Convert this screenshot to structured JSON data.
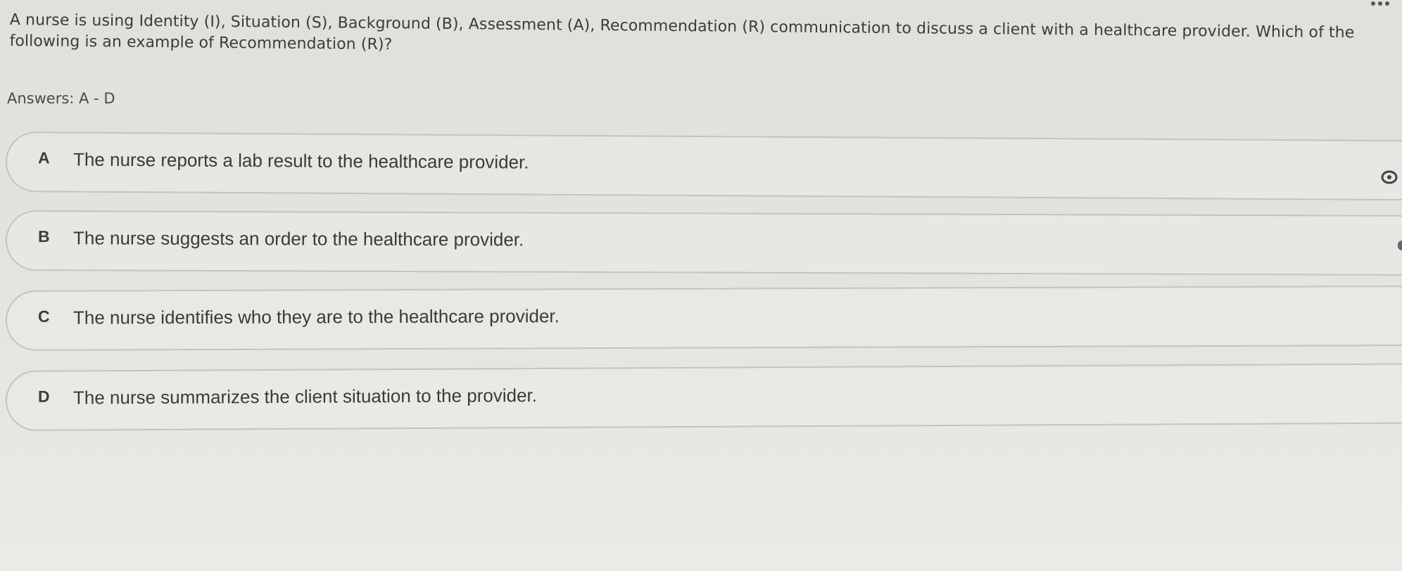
{
  "question": {
    "text": "A nurse is using Identity (I), Situation (S), Background (B), Assessment (A), Recommendation (R) communication to discuss a client with a healthcare provider. Which of the following is an example of Recommendation (R)?"
  },
  "answers_label": "Answers: A - D",
  "options": [
    {
      "letter": "A",
      "text": "The nurse reports a lab result to the healthcare provider."
    },
    {
      "letter": "B",
      "text": "The nurse suggests an order to the healthcare provider."
    },
    {
      "letter": "C",
      "text": "The nurse identifies who they are to the healthcare provider."
    },
    {
      "letter": "D",
      "text": "The nurse summarizes the client situation to the provider."
    }
  ],
  "icons": {
    "more": "more-options-icon",
    "eye": "eye-icon"
  }
}
